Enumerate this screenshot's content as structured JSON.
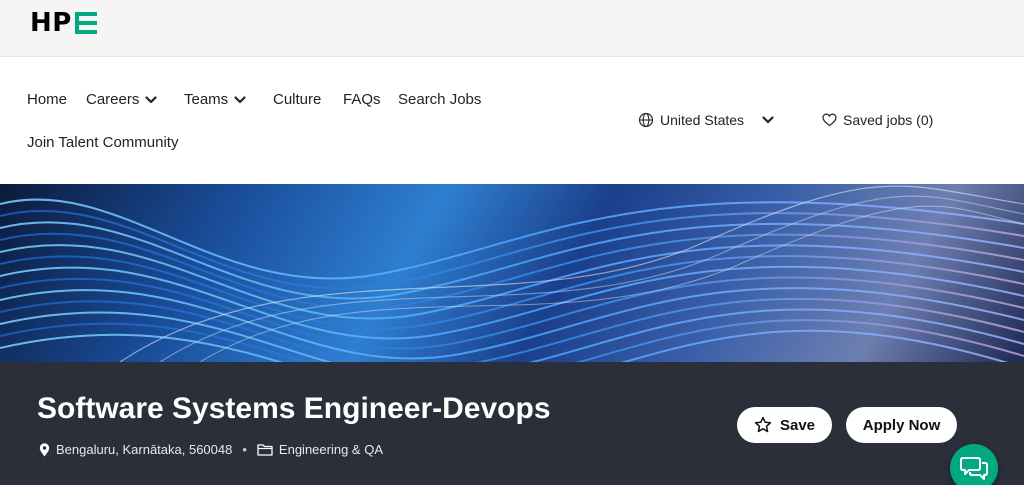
{
  "header": {
    "logo_text": "HP",
    "logo_accent_color": "#01a982"
  },
  "nav": {
    "items": [
      {
        "label": "Home",
        "has_dropdown": false
      },
      {
        "label": "Careers",
        "has_dropdown": true
      },
      {
        "label": "Teams",
        "has_dropdown": true
      },
      {
        "label": "Culture",
        "has_dropdown": false
      },
      {
        "label": "FAQs",
        "has_dropdown": false
      },
      {
        "label": "Search Jobs",
        "has_dropdown": false
      },
      {
        "label": "Join Talent Community",
        "has_dropdown": false
      }
    ],
    "region": {
      "label": "United States",
      "icon": "globe-icon"
    },
    "saved_jobs": {
      "label": "Saved jobs (0)",
      "icon": "heart-icon"
    }
  },
  "job": {
    "title": "Software Systems Engineer-Devops",
    "location": "Bengaluru, Karnātaka, 560048",
    "separator": "•",
    "category": "Engineering & QA",
    "save_label": "Save",
    "apply_label": "Apply Now"
  },
  "chat": {
    "icon": "chat-bubbles-icon"
  }
}
